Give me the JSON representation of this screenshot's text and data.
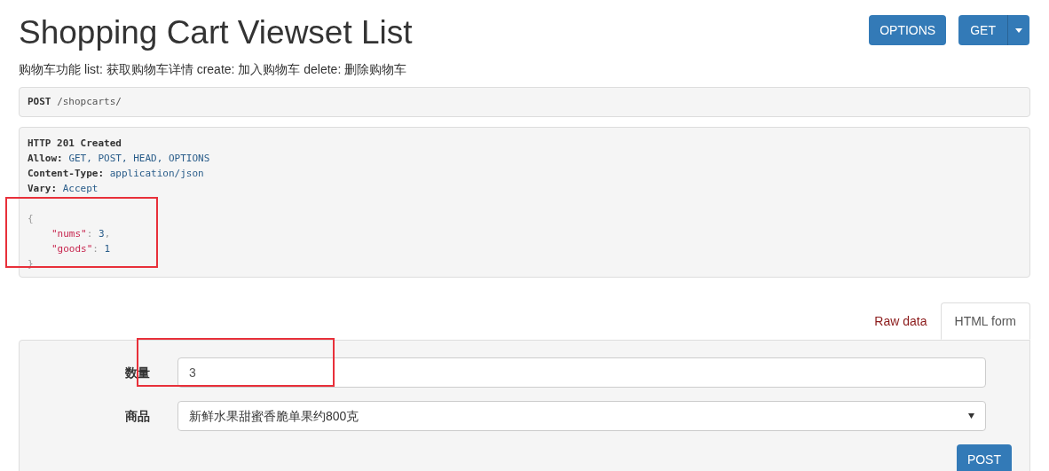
{
  "title": "Shopping Cart Viewset List",
  "description": "购物车功能 list: 获取购物车详情 create: 加入购物车 delete: 删除购物车",
  "header_buttons": [
    {
      "label": "OPTIONS",
      "kind": "plain"
    },
    {
      "label": "GET",
      "kind": "split"
    }
  ],
  "request": {
    "method": "POST",
    "path": "/shopcarts/"
  },
  "response": {
    "status": "HTTP 201 Created",
    "headers": [
      {
        "name": "Allow:",
        "value": "GET, POST, HEAD, OPTIONS"
      },
      {
        "name": "Content-Type:",
        "value": "application/json"
      },
      {
        "name": "Vary:",
        "value": "Accept"
      }
    ],
    "body": {
      "open": "{",
      "children": [
        [
          {
            "kind": "key",
            "text": "\"nums\""
          },
          {
            "kind": "punct",
            "text": ": "
          },
          {
            "kind": "number",
            "text": "3"
          },
          {
            "kind": "punct",
            "text": ","
          }
        ],
        [
          {
            "kind": "key",
            "text": "\"goods\""
          },
          {
            "kind": "punct",
            "text": ": "
          },
          {
            "kind": "number",
            "text": "1"
          }
        ]
      ],
      "close": "}"
    }
  },
  "tabs": [
    {
      "label": "Raw data",
      "selected": false
    },
    {
      "label": "HTML form",
      "selected": true
    }
  ],
  "form": {
    "fields": [
      {
        "label": "数量",
        "kind": "text",
        "value": "3"
      },
      {
        "label": "商品",
        "kind": "select",
        "value": "新鲜水果甜蜜香脆单果约800克"
      }
    ],
    "submit": "POST"
  }
}
